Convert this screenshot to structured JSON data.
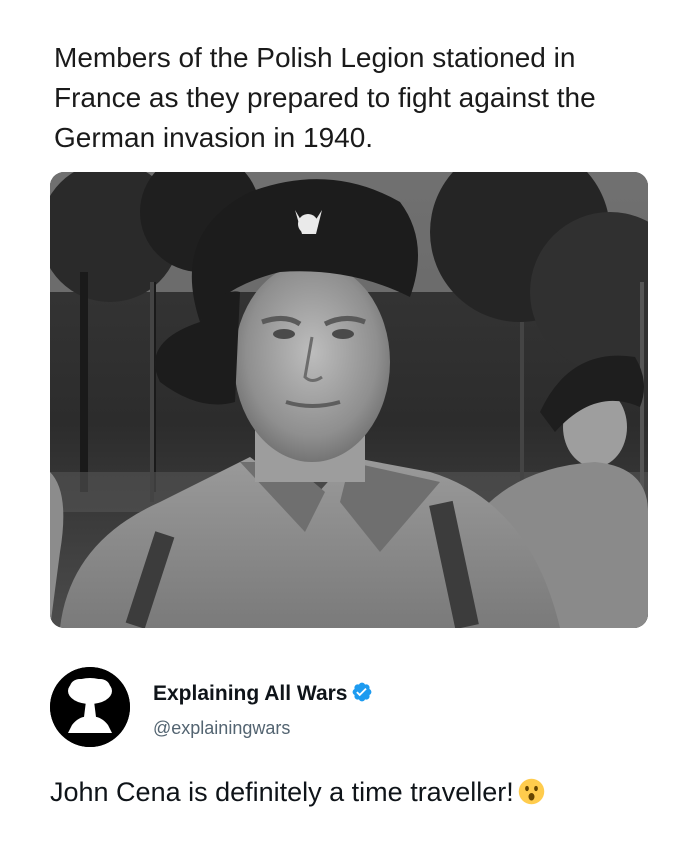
{
  "post": {
    "caption": "Members of the Polish Legion stationed in France as they prepared to fight against the German invasion in 1940."
  },
  "photo": {
    "icon": "black-and-white-portrait-image",
    "description_icon": "soldier-photo"
  },
  "author": {
    "name": "Explaining All Wars",
    "handle": "@explainingwars",
    "verified": true,
    "verified_color": "#1d9bf0",
    "avatar_icon": "mushroom-cloud-icon"
  },
  "reply": {
    "text": "John Cena is definitely a time traveller!",
    "emoji": "surprised-face-emoji"
  },
  "colors": {
    "text": "#0f1419",
    "handle": "#536471",
    "verified": "#1d9bf0"
  }
}
